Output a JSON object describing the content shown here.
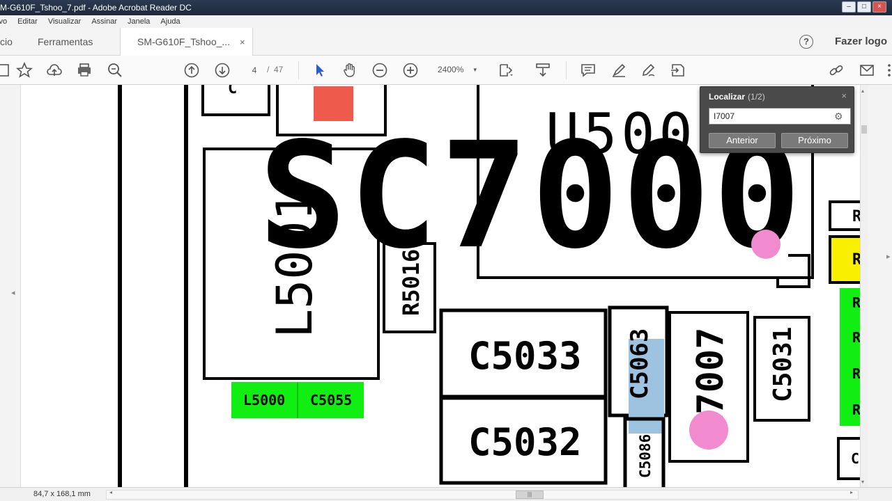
{
  "window": {
    "title": "M-G610F_Tshoo_7.pdf - Adobe Acrobat Reader DC",
    "controls": [
      "–",
      "□",
      "×"
    ]
  },
  "menu": {
    "items": [
      "ivo",
      "Editar",
      "Visualizar",
      "Assinar",
      "Janela",
      "Ajuda"
    ]
  },
  "tabs": {
    "home_label": "cio",
    "tools_label": "Ferramentas",
    "doc_label": "SM-G610F_Tshoo_...",
    "close_glyph": "×",
    "help_glyph": "?",
    "signin_label": "Fazer logo"
  },
  "toolbar": {
    "page_current": "4",
    "page_separator": "/",
    "page_total": "47",
    "zoom": "2400%",
    "zoom_caret": "▾"
  },
  "find": {
    "title": "Localizar",
    "count": "(1/2)",
    "close_glyph": "×",
    "query": "I7007",
    "gear_glyph": "⚙",
    "prev_label": "Anterior",
    "next_label": "Próximo"
  },
  "schematic": {
    "big_label": "SC7000",
    "u_label": "U500",
    "l5001": "L5001",
    "r5016": "R5016",
    "c5033": "C5033",
    "c5032": "C5032",
    "c5063": "C5063",
    "c5086": "C5086",
    "l7007": "L7007",
    "c5031": "C5031",
    "l5000": "L5000",
    "c5055": "C5055",
    "r_edge": "R",
    "c_edge": "C",
    "c_top": "C",
    "colors": {
      "red_pad": "#ee5a4c",
      "green_pad": "#11ee11",
      "yellow_pad": "#f8f000",
      "pink_marker": "#f28ad0",
      "blue_highlight": "#9ec3e0"
    }
  },
  "status": {
    "dimensions": "84,7 x 168,1 mm",
    "scroll_left": "◂",
    "scroll_right": "▸",
    "thumb_grip": "|||"
  },
  "gutter": {
    "left_arrow": "◂",
    "right_arrow": "▸",
    "up_arrow": "▴",
    "down_arrow": "▾"
  }
}
